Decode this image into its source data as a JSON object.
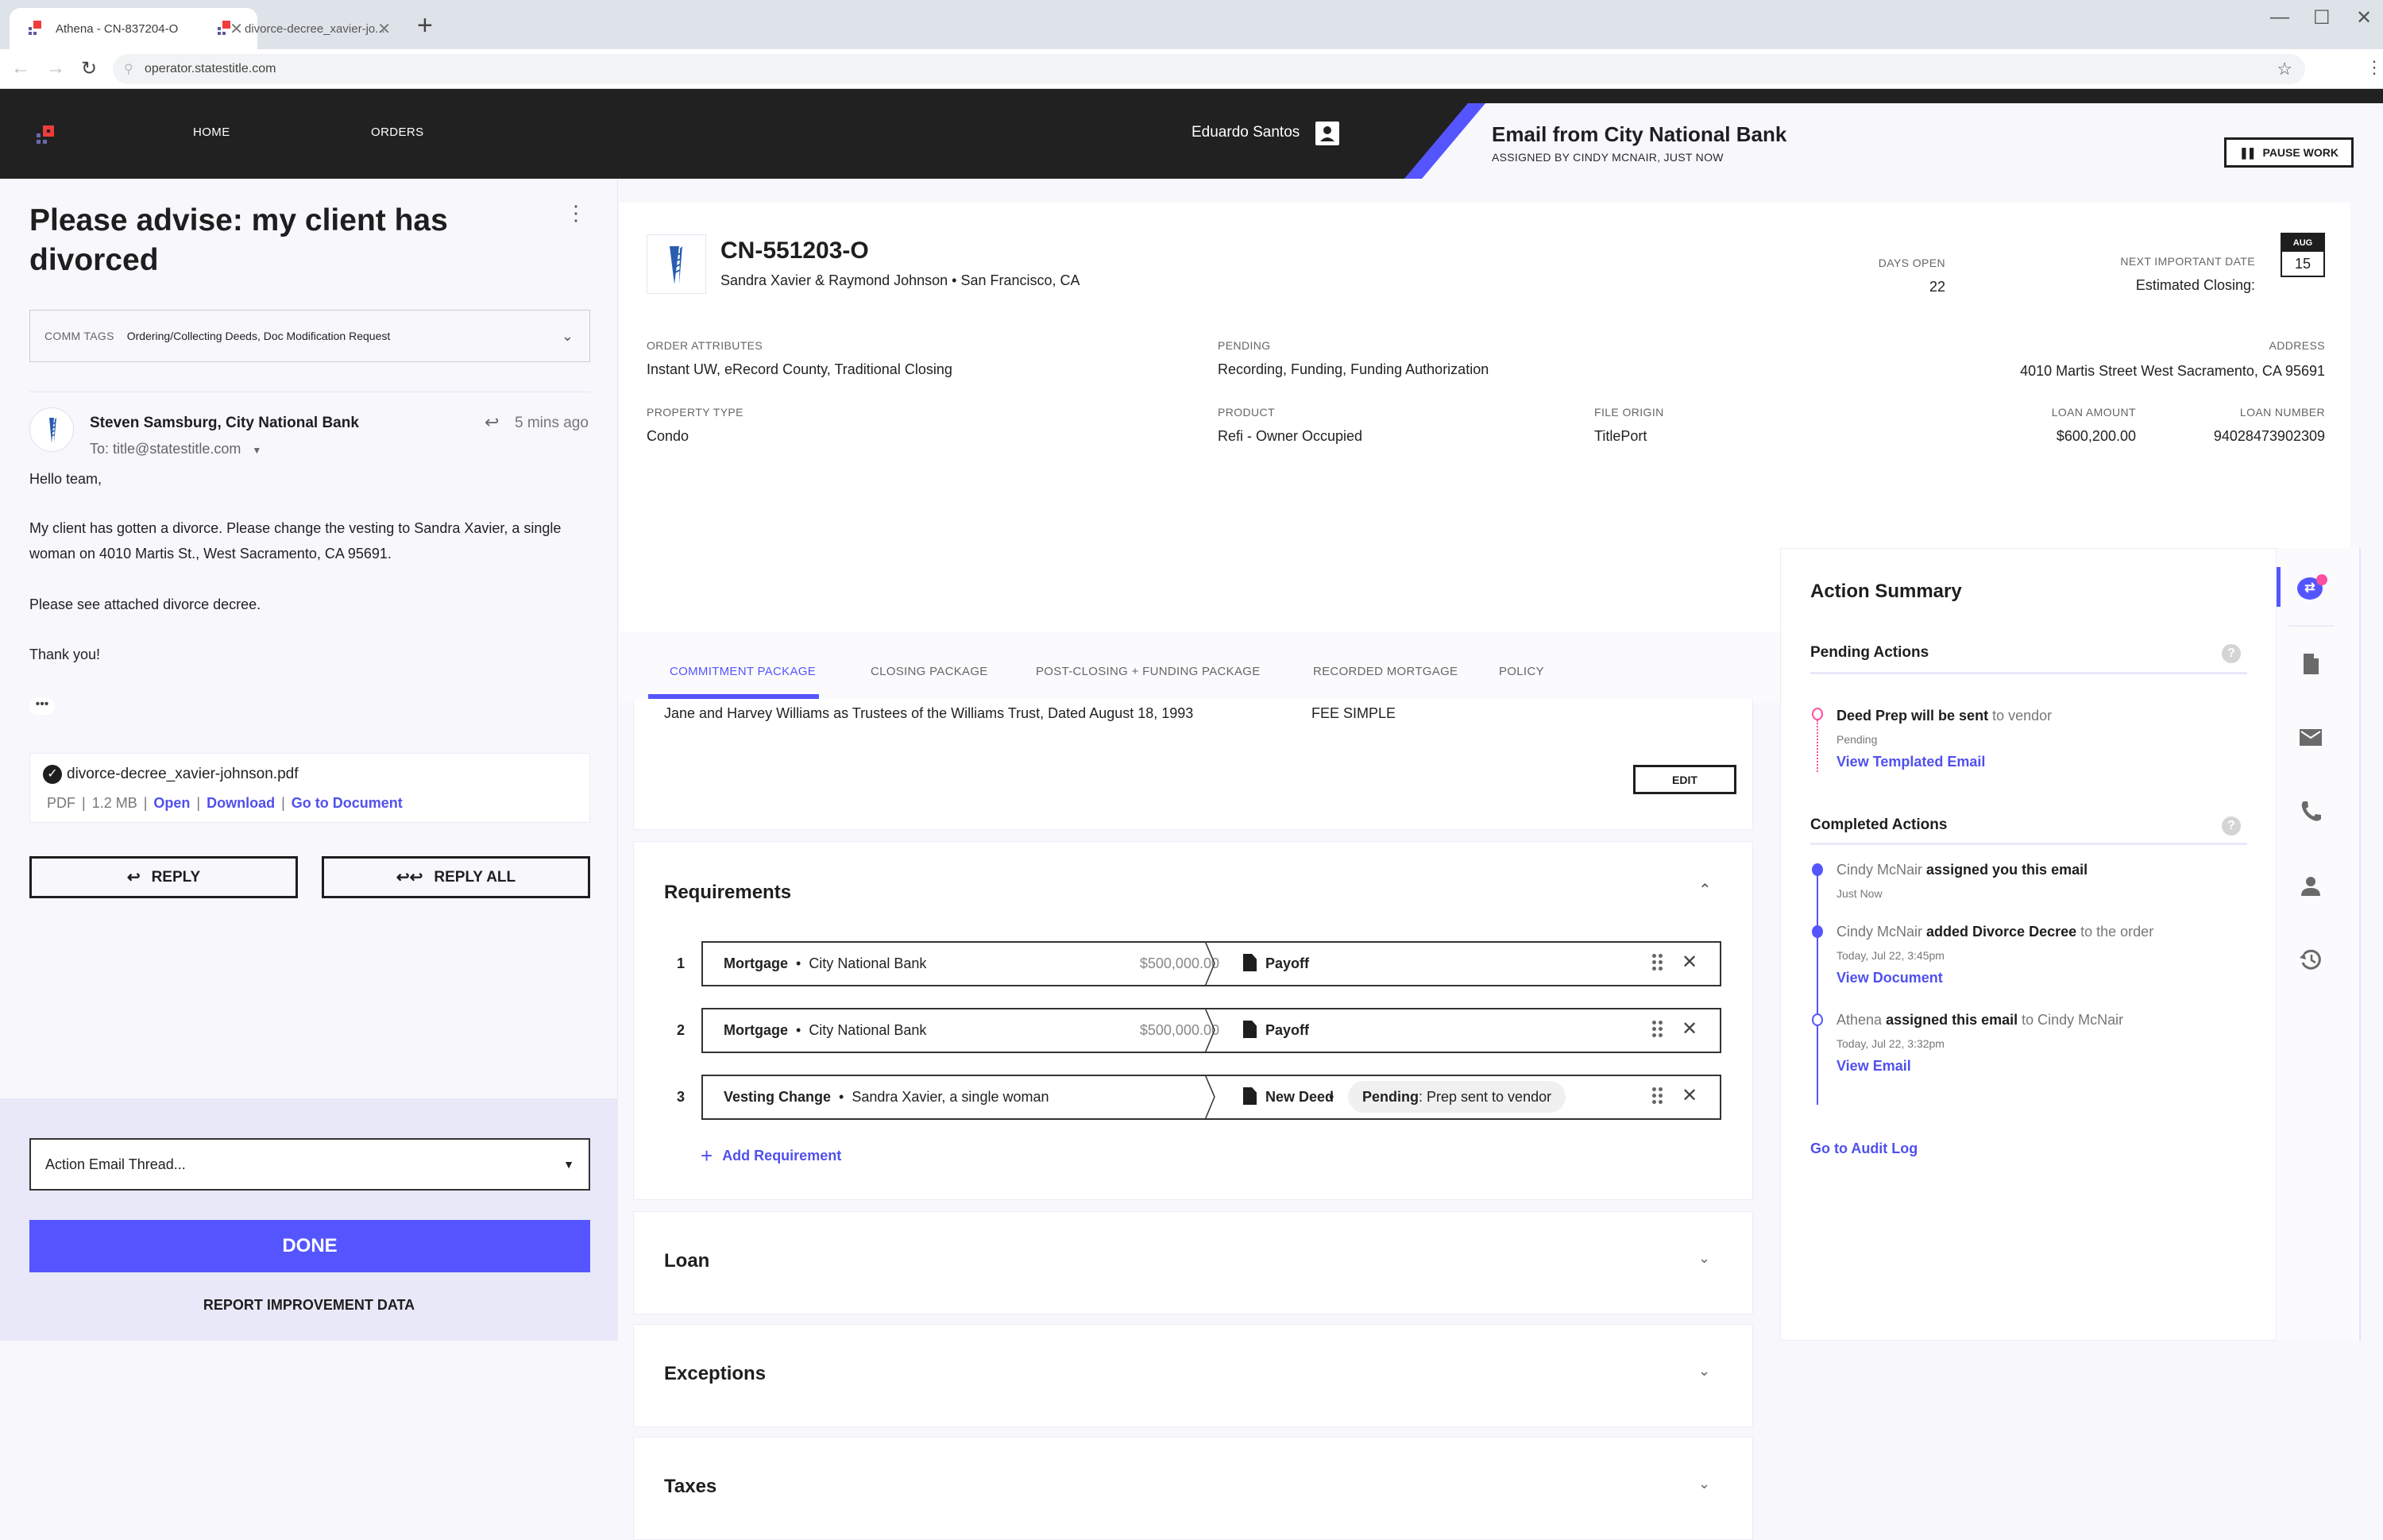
{
  "browser": {
    "tabs": [
      {
        "title": "Athena - CN-837204-O",
        "active": true
      },
      {
        "title": "divorce-decree_xavier-jo...",
        "active": false
      }
    ],
    "url": "operator.statestitle.com"
  },
  "nav": {
    "home": "HOME",
    "orders": "ORDERS",
    "user_name": "Eduardo Santos"
  },
  "work": {
    "title": "Email from City National Bank",
    "subtitle": "ASSIGNED BY CINDY MCNAIR, JUST NOW",
    "pause_label": "PAUSE WORK"
  },
  "email": {
    "subject": "Please advise: my client has divorced",
    "comm_tags_label": "COMM TAGS",
    "comm_tags_value": "Ordering/Collecting Deeds, Doc Modification Request",
    "sender": "Steven Samsburg, City National Bank",
    "to": "To: title@statestitle.com",
    "time": "5 mins ago",
    "body": [
      "Hello team,",
      "My client has gotten a divorce. Please change the vesting to Sandra Xavier, a single woman on 4010 Martis St., West Sacramento, CA 95691.",
      "Please see attached divorce decree.",
      "Thank you!"
    ],
    "ellipsis": "•••",
    "attachment": {
      "name": "divorce-decree_xavier-johnson.pdf",
      "type": "PDF",
      "size": "1.2 MB",
      "open": "Open",
      "download": "Download",
      "goto": "Go to Document"
    },
    "reply_label": "REPLY",
    "reply_all_label": "REPLY ALL",
    "action_select": "Action Email Thread...",
    "done_label": "DONE",
    "report_label": "REPORT IMPROVEMENT DATA"
  },
  "order": {
    "number": "CN-551203-O",
    "parties": "Sandra Xavier & Raymond Johnson • San Francisco, CA",
    "days_open_label": "DAYS OPEN",
    "days_open": "22",
    "next_date_label": "NEXT IMPORTANT DATE",
    "next_date_desc": "Estimated Closing:",
    "next_date_month": "AUG",
    "next_date_day": "15",
    "attributes_label": "ORDER ATTRIBUTES",
    "attributes": "Instant UW, eRecord County, Traditional Closing",
    "pending_label": "PENDING",
    "pending": "Recording, Funding, Funding Authorization",
    "address_label": "ADDRESS",
    "address": "4010 Martis Street West Sacramento, CA 95691",
    "property_type_label": "PROPERTY TYPE",
    "property_type": "Condo",
    "product_label": "PRODUCT",
    "product": "Refi - Owner Occupied",
    "file_origin_label": "FILE ORIGIN",
    "file_origin": "TitlePort",
    "loan_amount_label": "LOAN AMOUNT",
    "loan_amount": "$600,200.00",
    "loan_number_label": "LOAN NUMBER",
    "loan_number": "94028473902309"
  },
  "package_tabs": [
    {
      "label": "COMMITMENT PACKAGE",
      "active": true
    },
    {
      "label": "CLOSING PACKAGE",
      "active": false
    },
    {
      "label": "POST-CLOSING + FUNDING PACKAGE",
      "active": false
    },
    {
      "label": "RECORDED MORTGAGE",
      "active": false
    },
    {
      "label": "POLICY",
      "active": false
    }
  ],
  "vesting": {
    "text": "Jane and Harvey Williams as Trustees of the Williams Trust, Dated August 18, 1993",
    "type": "FEE SIMPLE",
    "edit_label": "EDIT"
  },
  "requirements": {
    "title": "Requirements",
    "items": [
      {
        "num": "1",
        "kind": "Mortgage",
        "party": "City National Bank",
        "amount": "$500,000.00",
        "doc": "Payoff",
        "status_label": "",
        "status": ""
      },
      {
        "num": "2",
        "kind": "Mortgage",
        "party": "City National Bank",
        "amount": "$500,000.00",
        "doc": "Payoff",
        "status_label": "",
        "status": ""
      },
      {
        "num": "3",
        "kind": "Vesting Change",
        "party": "Sandra Xavier, a single woman",
        "amount": "",
        "doc": "New Deed",
        "status_label": "Pending",
        "status": ": Prep sent to vendor"
      }
    ],
    "add_label": "Add Requirement"
  },
  "sections": [
    "Loan",
    "Exceptions",
    "Taxes"
  ],
  "action_summary": {
    "title": "Action Summary",
    "pending_title": "Pending Actions",
    "pending": [
      {
        "bold": "Deed Prep will be sent",
        "rest": " to vendor",
        "status": "Pending",
        "link": "View Templated Email"
      }
    ],
    "completed_title": "Completed Actions",
    "completed": [
      {
        "actor": "Cindy McNair ",
        "bold": "assigned you this email",
        "rest": "",
        "time": "Just Now",
        "link": ""
      },
      {
        "actor": "Cindy McNair ",
        "bold": "added Divorce Decree",
        "rest": " to the order",
        "time": "Today, Jul 22, 3:45pm",
        "link": "View Document"
      },
      {
        "actor": "Athena ",
        "bold": "assigned this email",
        "rest": " to Cindy McNair",
        "time": "Today, Jul 22, 3:32pm",
        "link": "View Email"
      }
    ],
    "audit_link": "Go to Audit Log"
  },
  "colors": {
    "accent": "#5555ff",
    "pending_pink": "#ff4fa0",
    "nav_bg": "#212121",
    "logo_red": "#f03c3c"
  }
}
